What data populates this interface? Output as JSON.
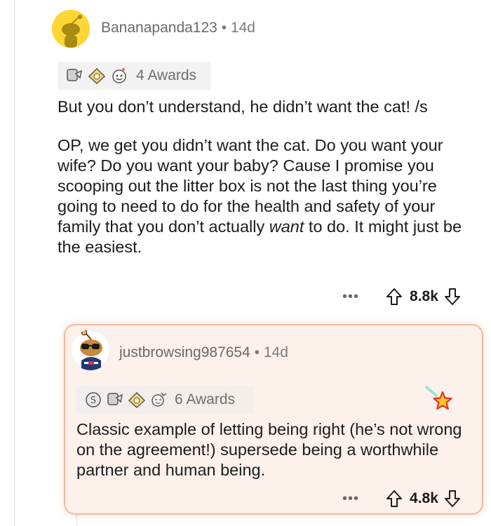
{
  "comment": {
    "username": "Bananapanda123",
    "separator": "•",
    "age": "14d",
    "awards_label": "4 Awards",
    "paragraph_1": "But you don’t understand, he didn’t want the cat! /s",
    "paragraph_2_before": "OP, we get you didn’t want the cat. Do you want your wife? Do you want your baby? Cause I promise you scooping out the litter box is not the last thing you’re going to need to do for the health and safety of your family that you don’t actually ",
    "paragraph_2_emphasis": "want",
    "paragraph_2_after": " to do. It might just be the easiest.",
    "more_label": "•••",
    "score": "8.8k"
  },
  "reply": {
    "username": "justbrowsing987654",
    "separator": "•",
    "age": "14d",
    "awards_label": "6 Awards",
    "body": "Classic example of letting being right (he’s not wrong on the agreement!) supersede being a worthwhile partner and human being.",
    "more_label": "•••",
    "score": "4.8k"
  },
  "icons": {
    "award_1": "silver-award-icon",
    "award_2": "gold-award-icon",
    "award_3": "helpful-award-icon",
    "award_4": "wholesome-award-icon",
    "upvote": "upvote-arrow-icon",
    "downvote": "downvote-arrow-icon",
    "star": "star-icon"
  },
  "colors": {
    "avatar_yellow": "#ffd635",
    "reply_card_border": "#f5b9a0",
    "reply_card_bg": "#fdf1ec",
    "star_gold": "#ffb000"
  }
}
